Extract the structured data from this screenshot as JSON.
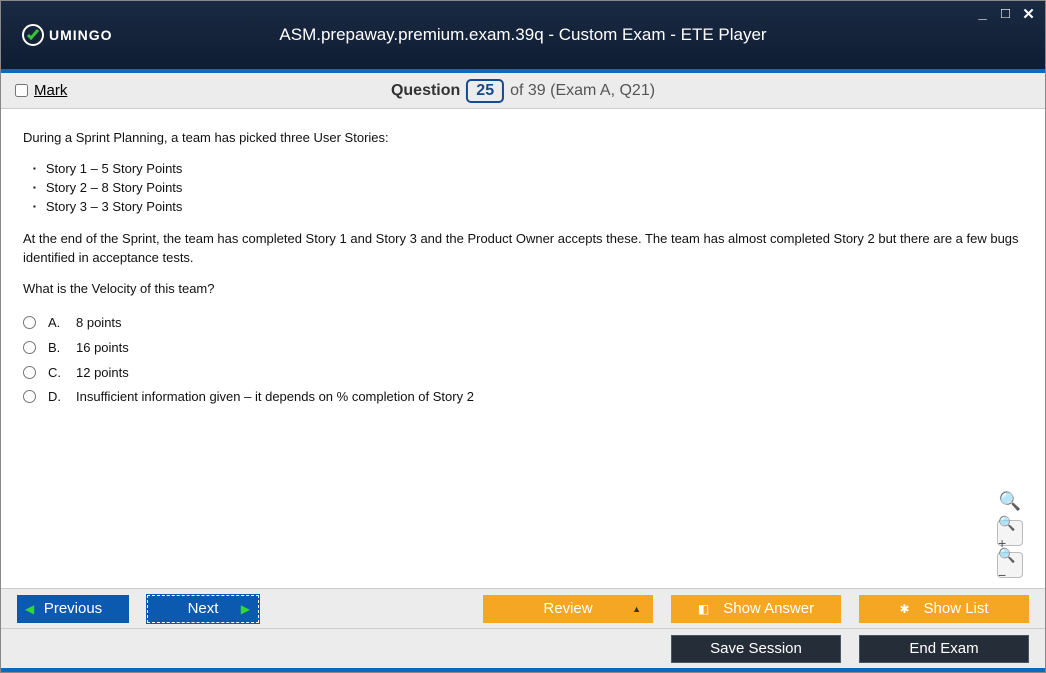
{
  "logo_text": "UMINGO",
  "window_title": "ASM.prepaway.premium.exam.39q - Custom Exam - ETE Player",
  "mark_label": "Mark",
  "question_word": "Question",
  "question_current": "25",
  "question_total_text": "of 39 (Exam A, Q21)",
  "q_intro": "During a Sprint Planning, a team has picked three User Stories:",
  "stories": [
    "Story 1 – 5 Story Points",
    "Story 2 – 8 Story Points",
    "Story 3 – 3 Story Points"
  ],
  "q_body": "At the end of the Sprint, the team has completed Story 1 and Story 3 and the Product Owner accepts these. The team has almost completed Story 2 but there are a few bugs identified in acceptance tests.",
  "q_ask": "What is the Velocity of this team?",
  "options": [
    {
      "letter": "A.",
      "text": "8 points"
    },
    {
      "letter": "B.",
      "text": "16 points"
    },
    {
      "letter": "C.",
      "text": "12 points"
    },
    {
      "letter": "D.",
      "text": "Insufficient information given – it depends on % completion of Story 2"
    }
  ],
  "buttons": {
    "previous": "Previous",
    "next": "Next",
    "review": "Review",
    "show_answer": "Show Answer",
    "show_list": "Show List",
    "save_session": "Save Session",
    "end_exam": "End Exam"
  }
}
